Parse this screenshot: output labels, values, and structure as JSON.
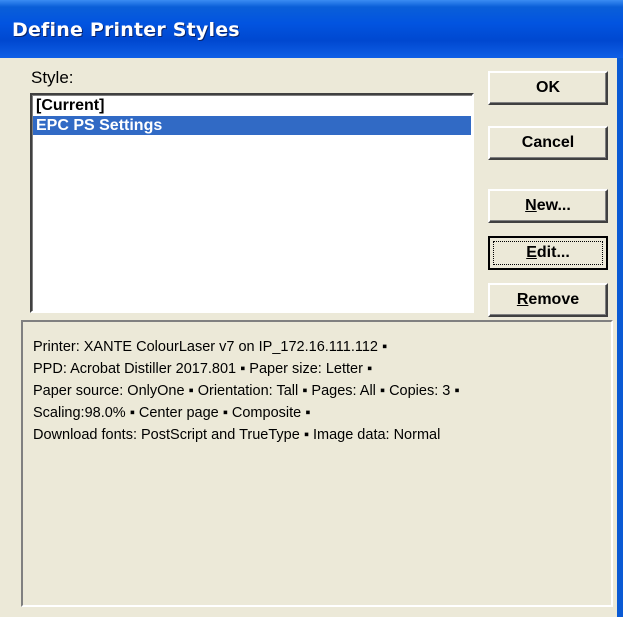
{
  "window": {
    "title": "Define Printer Styles"
  },
  "style_list": {
    "label": "Style:",
    "items": [
      {
        "label": "[Current]",
        "selected": false
      },
      {
        "label": "EPC PS Settings",
        "selected": true
      }
    ]
  },
  "buttons": {
    "ok": "OK",
    "cancel": "Cancel",
    "new_mnemonic": "N",
    "new_rest": "ew...",
    "edit_mnemonic": "E",
    "edit_rest": "dit...",
    "remove_mnemonic": "R",
    "remove_rest": "emove"
  },
  "description": {
    "lines": [
      "Printer: XANTE ColourLaser v7 on IP_172.16.111.112 ▪",
      "PPD: Acrobat Distiller 2017.801 ▪ Paper size: Letter ▪",
      "Paper source: OnlyOne ▪ Orientation: Tall ▪ Pages: All ▪ Copies: 3 ▪",
      "Scaling:98.0% ▪ Center page ▪ Composite ▪",
      "Download fonts: PostScript and TrueType ▪ Image data: Normal"
    ]
  },
  "colors": {
    "title_bar": "#0254e0",
    "dialog_face": "#ece9d8",
    "selection": "#316ac5"
  }
}
